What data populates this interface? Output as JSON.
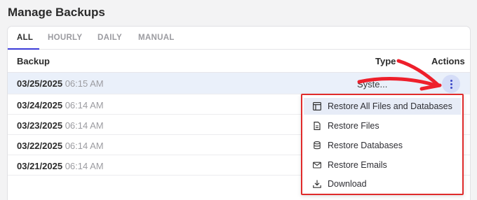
{
  "page_title": "Manage Backups",
  "tabs": [
    {
      "label": "ALL",
      "active": true
    },
    {
      "label": "HOURLY"
    },
    {
      "label": "DAILY"
    },
    {
      "label": "MANUAL"
    }
  ],
  "table": {
    "columns": {
      "backup": "Backup",
      "type": "Type",
      "actions": "Actions"
    },
    "rows": [
      {
        "date": "03/25/2025",
        "time": "06:15 AM",
        "type": "Syste..."
      },
      {
        "date": "03/24/2025",
        "time": "06:14 AM"
      },
      {
        "date": "03/23/2025",
        "time": "06:14 AM"
      },
      {
        "date": "03/22/2025",
        "time": "06:14 AM"
      },
      {
        "date": "03/21/2025",
        "time": "06:14 AM"
      }
    ]
  },
  "actions_menu": {
    "items": [
      {
        "label": "Restore All Files and Databases",
        "icon": "window-icon"
      },
      {
        "label": "Restore Files",
        "icon": "file-icon"
      },
      {
        "label": "Restore Databases",
        "icon": "database-icon"
      },
      {
        "label": "Restore Emails",
        "icon": "mail-icon"
      },
      {
        "label": "Download",
        "icon": "download-icon"
      }
    ]
  },
  "colors": {
    "accent": "#3b3bd8",
    "highlight": "#e02b2b"
  }
}
